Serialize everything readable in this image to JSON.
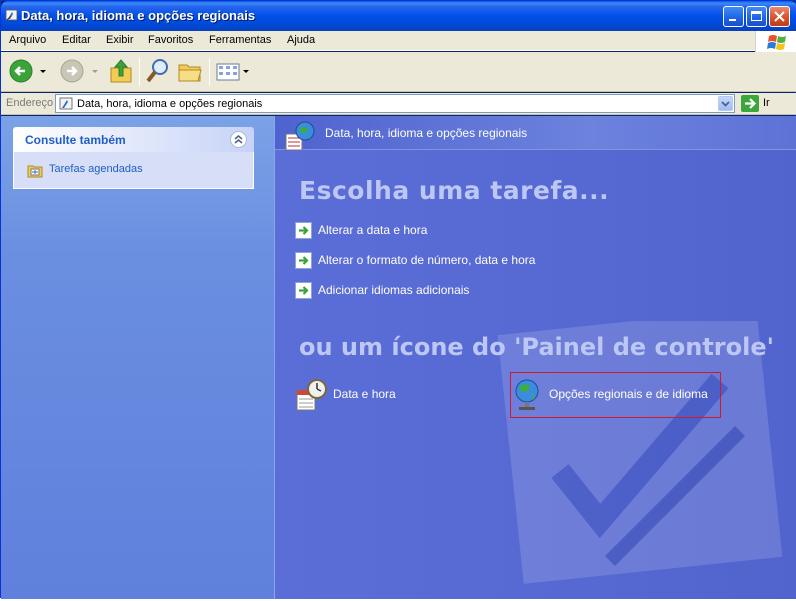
{
  "window": {
    "title": "Data, hora, idioma e opções regionais"
  },
  "menu": {
    "items": [
      "Arquivo",
      "Editar",
      "Exibir",
      "Favoritos",
      "Ferramentas",
      "Ajuda"
    ]
  },
  "address": {
    "label": "Endereço",
    "value": "Data, hora, idioma e opções regionais",
    "go_label": "Ir"
  },
  "sidebar": {
    "panel_title": "Consulte também",
    "items": [
      {
        "label": "Tarefas agendadas",
        "icon": "scheduled-tasks-icon"
      }
    ]
  },
  "main": {
    "header": "Data, hora, idioma e opções regionais",
    "task_heading": "Escolha uma tarefa...",
    "tasks": [
      {
        "label": "Alterar a data e hora"
      },
      {
        "label": "Alterar o formato de número, data e hora"
      },
      {
        "label": "Adicionar idiomas adicionais"
      }
    ],
    "icon_heading": "ou um ícone do 'Painel de controle'",
    "icons": [
      {
        "label": "Data e hora",
        "icon": "date-time-icon"
      },
      {
        "label": "Opções regionais e de idioma",
        "icon": "globe-icon",
        "highlighted": true
      }
    ]
  },
  "colors": {
    "highlight_border": "#d01a2a",
    "heading": "#bcc8f3",
    "link": "#215dc6"
  }
}
